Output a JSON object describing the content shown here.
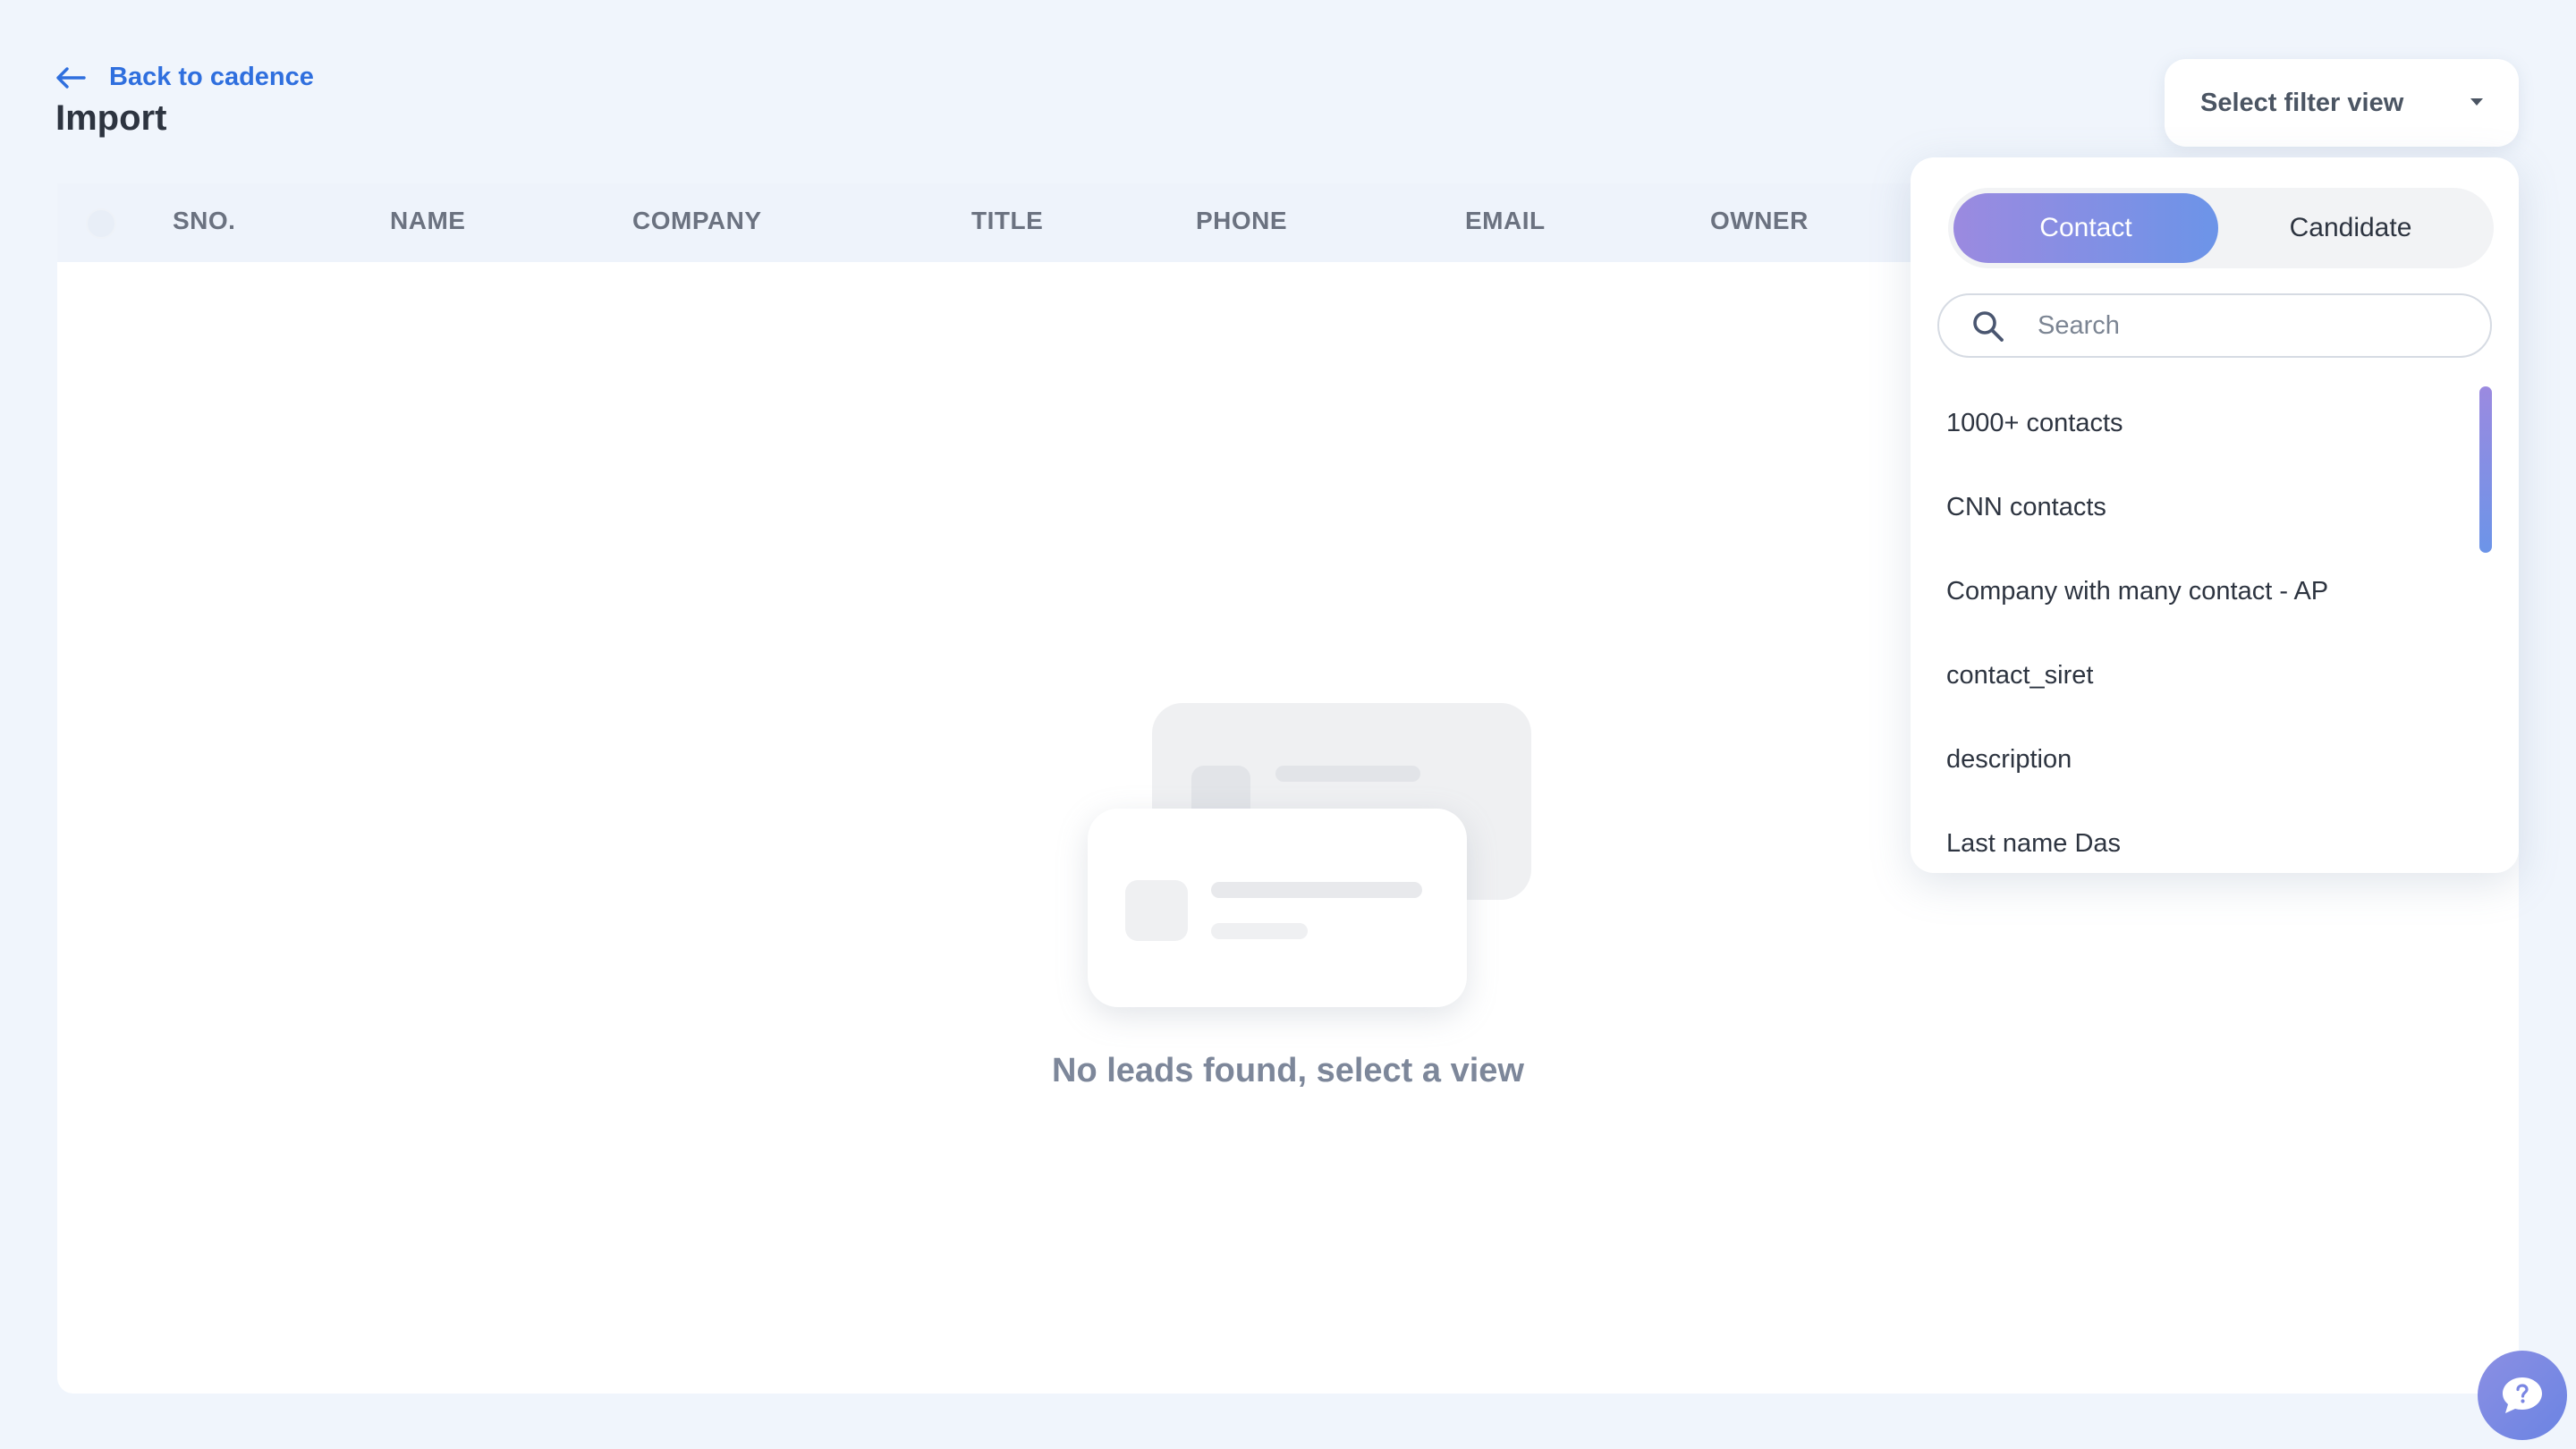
{
  "header": {
    "back_label": "Back to cadence",
    "title": "Import"
  },
  "table": {
    "columns": [
      "SNO.",
      "NAME",
      "COMPANY",
      "TITLE",
      "PHONE",
      "EMAIL",
      "OWNER"
    ]
  },
  "empty_state": {
    "message": "No leads found, select a view"
  },
  "filter": {
    "select_label": "Select filter view",
    "tabs": [
      {
        "label": "Contact",
        "active": true
      },
      {
        "label": "Candidate",
        "active": false
      }
    ],
    "search_placeholder": "Search",
    "views": [
      "1000+ contacts",
      "CNN contacts",
      "Company with many contact - AP",
      "contact_siret",
      "description",
      "Last name Das"
    ]
  },
  "icons": {
    "back": "arrow-left-icon",
    "caret": "caret-down-icon",
    "search": "search-icon",
    "help": "chat-question-icon"
  },
  "colors": {
    "accent_link": "#2f6fde",
    "gradient_start": "#9b8ae0",
    "gradient_end": "#6c94e8",
    "background": "#f0f5fc"
  }
}
